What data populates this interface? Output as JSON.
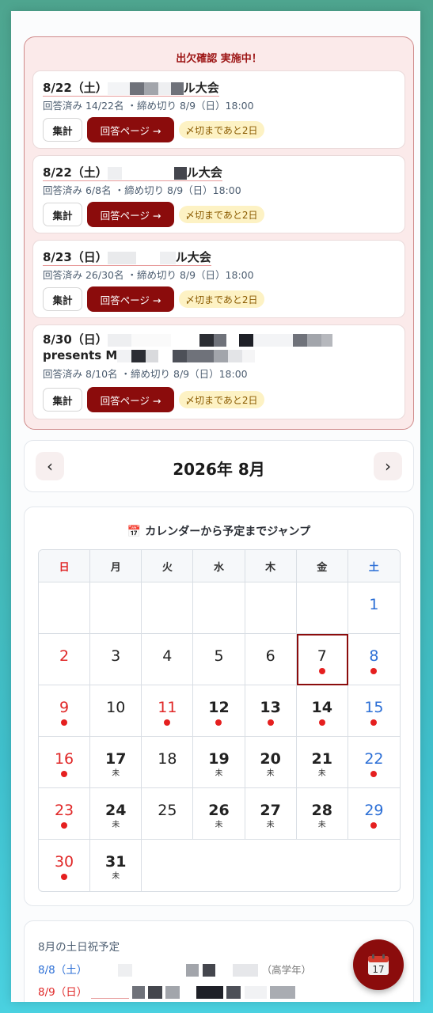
{
  "attendance": {
    "title": "出欠確認 実施中！",
    "summary_label": "集計",
    "answer_label": "回答ページ →",
    "events": [
      {
        "title_start": "8/22（土）",
        "title_end": "ル大会",
        "meta": "回答済み 14/22名 ・締め切り 8/9（日）18:00",
        "badge": "〆切まであと2日"
      },
      {
        "title_start": "8/22（土）",
        "title_end": "ル大会",
        "meta": "回答済み 6/8名 ・締め切り 8/9（日）18:00",
        "badge": "〆切まであと2日"
      },
      {
        "title_start": "8/23（日）",
        "title_end": "ル大会",
        "meta": "回答済み 26/30名 ・締め切り 8/9（日）18:00",
        "badge": "〆切まであと2日"
      },
      {
        "title_start": "8/30（日）",
        "title_line2": "presents M",
        "meta": "回答済み 8/10名 ・締め切り 8/9（日）18:00",
        "badge": "〆切まであと2日"
      }
    ]
  },
  "month_nav": {
    "label": "2026年 8月",
    "prev": "‹",
    "next": "›"
  },
  "calendar": {
    "heading": "📅 カレンダーから予定までジャンプ",
    "weekdays": [
      "日",
      "月",
      "火",
      "水",
      "木",
      "金",
      "土"
    ],
    "mark": "未",
    "days": [
      {
        "d": "1",
        "col": 7,
        "dot": false,
        "bold": false,
        "mark": false
      },
      {
        "d": "2",
        "col": 1,
        "dot": false,
        "bold": false,
        "mark": false
      },
      {
        "d": "3",
        "col": 2,
        "dot": false,
        "bold": false,
        "mark": false
      },
      {
        "d": "4",
        "col": 3,
        "dot": false,
        "bold": false,
        "mark": false
      },
      {
        "d": "5",
        "col": 4,
        "dot": false,
        "bold": false,
        "mark": false
      },
      {
        "d": "6",
        "col": 5,
        "dot": false,
        "bold": false,
        "mark": false
      },
      {
        "d": "7",
        "col": 6,
        "dot": true,
        "bold": false,
        "mark": false,
        "today": true
      },
      {
        "d": "8",
        "col": 7,
        "dot": true,
        "bold": false,
        "mark": false
      },
      {
        "d": "9",
        "col": 1,
        "dot": true,
        "bold": false,
        "mark": false
      },
      {
        "d": "10",
        "col": 2,
        "dot": false,
        "bold": false,
        "mark": false
      },
      {
        "d": "11",
        "col": 3,
        "dot": true,
        "bold": false,
        "mark": false,
        "holiday": true
      },
      {
        "d": "12",
        "col": 4,
        "dot": true,
        "bold": true,
        "mark": false
      },
      {
        "d": "13",
        "col": 5,
        "dot": true,
        "bold": true,
        "mark": false
      },
      {
        "d": "14",
        "col": 6,
        "dot": true,
        "bold": true,
        "mark": false
      },
      {
        "d": "15",
        "col": 7,
        "dot": true,
        "bold": false,
        "mark": false
      },
      {
        "d": "16",
        "col": 1,
        "dot": true,
        "bold": false,
        "mark": false
      },
      {
        "d": "17",
        "col": 2,
        "dot": false,
        "bold": true,
        "mark": true
      },
      {
        "d": "18",
        "col": 3,
        "dot": false,
        "bold": false,
        "mark": false
      },
      {
        "d": "19",
        "col": 4,
        "dot": false,
        "bold": true,
        "mark": true
      },
      {
        "d": "20",
        "col": 5,
        "dot": false,
        "bold": true,
        "mark": true
      },
      {
        "d": "21",
        "col": 6,
        "dot": false,
        "bold": true,
        "mark": true
      },
      {
        "d": "22",
        "col": 7,
        "dot": true,
        "bold": false,
        "mark": false
      },
      {
        "d": "23",
        "col": 1,
        "dot": true,
        "bold": false,
        "mark": false
      },
      {
        "d": "24",
        "col": 2,
        "dot": false,
        "bold": true,
        "mark": true
      },
      {
        "d": "25",
        "col": 3,
        "dot": false,
        "bold": false,
        "mark": false
      },
      {
        "d": "26",
        "col": 4,
        "dot": false,
        "bold": true,
        "mark": true
      },
      {
        "d": "27",
        "col": 5,
        "dot": false,
        "bold": true,
        "mark": true
      },
      {
        "d": "28",
        "col": 6,
        "dot": false,
        "bold": true,
        "mark": true
      },
      {
        "d": "29",
        "col": 7,
        "dot": true,
        "bold": false,
        "mark": false
      },
      {
        "d": "30",
        "col": 1,
        "dot": true,
        "bold": false,
        "mark": false
      },
      {
        "d": "31",
        "col": 2,
        "dot": false,
        "bold": true,
        "mark": true
      }
    ]
  },
  "weekend_list": {
    "title": "8月の土日祝予定",
    "rows": [
      {
        "date": "8/8（土）",
        "suffix": "（高学年）"
      },
      {
        "date": "8/9（日）",
        "suffix": ""
      }
    ]
  },
  "fab": {
    "icon": "📅",
    "day": "17"
  },
  "colors": {
    "accent": "#8b0c0c",
    "sunday": "#e02828",
    "saturday": "#2c6fd6",
    "dot": "#e51f1f"
  }
}
